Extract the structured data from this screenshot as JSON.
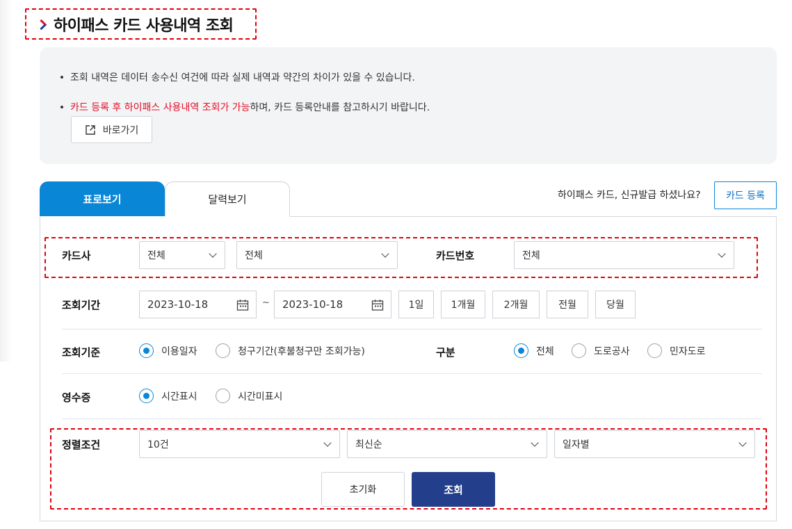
{
  "page": {
    "title": "하이패스 카드 사용내역 조회"
  },
  "notice": {
    "line1": "조회 내역은 데이터 송수신 여건에 따라 실제 내역과 약간의 차이가 있을 수 있습니다.",
    "line2_red": "카드 등록 후 하이패스 사용내역 조회가 가능",
    "line2_rest": "하며, 카드 등록안내를 참고하시기 바랍니다.",
    "shortcut_label": "바로가기"
  },
  "tabs": [
    {
      "label": "표로보기",
      "active": true
    },
    {
      "label": "달력보기",
      "active": false
    }
  ],
  "register": {
    "question": "하이패스 카드, 신규발급 하셨나요?",
    "button_label": "카드 등록"
  },
  "form": {
    "card_company": {
      "label": "카드사",
      "select1": "전체",
      "select2": "전체"
    },
    "card_number": {
      "label": "카드번호",
      "select": "전체"
    },
    "period": {
      "label": "조회기간",
      "start": "2023-10-18",
      "tilde": "~",
      "end": "2023-10-18",
      "buttons": [
        "1일",
        "1개월",
        "2개월",
        "전월",
        "당월"
      ]
    },
    "basis": {
      "label": "조회기준",
      "options": [
        {
          "label": "이용일자",
          "checked": true
        },
        {
          "label": "청구기간(후불청구만 조회가능)",
          "checked": false
        }
      ]
    },
    "category": {
      "label": "구분",
      "options": [
        {
          "label": "전체",
          "checked": true
        },
        {
          "label": "도로공사",
          "checked": false
        },
        {
          "label": "민자도로",
          "checked": false
        }
      ]
    },
    "receipt": {
      "label": "영수증",
      "options": [
        {
          "label": "시간표시",
          "checked": true
        },
        {
          "label": "시간미표시",
          "checked": false
        }
      ]
    },
    "sort": {
      "label": "정렬조건",
      "count": "10건",
      "order": "최신순",
      "group": "일자별"
    },
    "reset_label": "초기화",
    "search_label": "조회"
  },
  "colors": {
    "accent": "#0a86d6",
    "primary_button": "#233f8c",
    "highlight_red": "#e0102a"
  }
}
